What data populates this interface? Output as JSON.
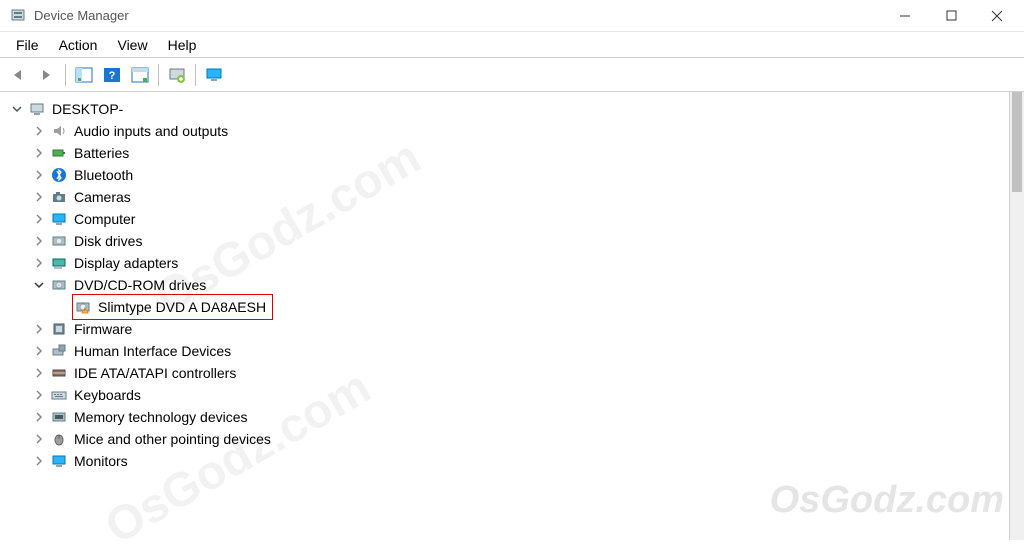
{
  "window": {
    "title": "Device Manager"
  },
  "menu": {
    "file": "File",
    "action": "Action",
    "view": "View",
    "help": "Help"
  },
  "tree": {
    "root": "DESKTOP-",
    "items": [
      {
        "label": "Audio inputs and outputs",
        "icon": "speaker"
      },
      {
        "label": "Batteries",
        "icon": "battery"
      },
      {
        "label": "Bluetooth",
        "icon": "bluetooth"
      },
      {
        "label": "Cameras",
        "icon": "camera"
      },
      {
        "label": "Computer",
        "icon": "computer"
      },
      {
        "label": "Disk drives",
        "icon": "disk"
      },
      {
        "label": "Display adapters",
        "icon": "display"
      },
      {
        "label": "DVD/CD-ROM drives",
        "icon": "dvd",
        "expanded": true,
        "children": [
          {
            "label": "Slimtype DVD A  DA8AESH",
            "icon": "dvd-warn",
            "highlight": true
          }
        ]
      },
      {
        "label": "Firmware",
        "icon": "firmware"
      },
      {
        "label": "Human Interface Devices",
        "icon": "hid"
      },
      {
        "label": "IDE ATA/ATAPI controllers",
        "icon": "ide"
      },
      {
        "label": "Keyboards",
        "icon": "keyboard"
      },
      {
        "label": "Memory technology devices",
        "icon": "memory"
      },
      {
        "label": "Mice and other pointing devices",
        "icon": "mouse"
      },
      {
        "label": "Monitors",
        "icon": "monitor"
      }
    ]
  },
  "watermark": "OsGodz.com"
}
